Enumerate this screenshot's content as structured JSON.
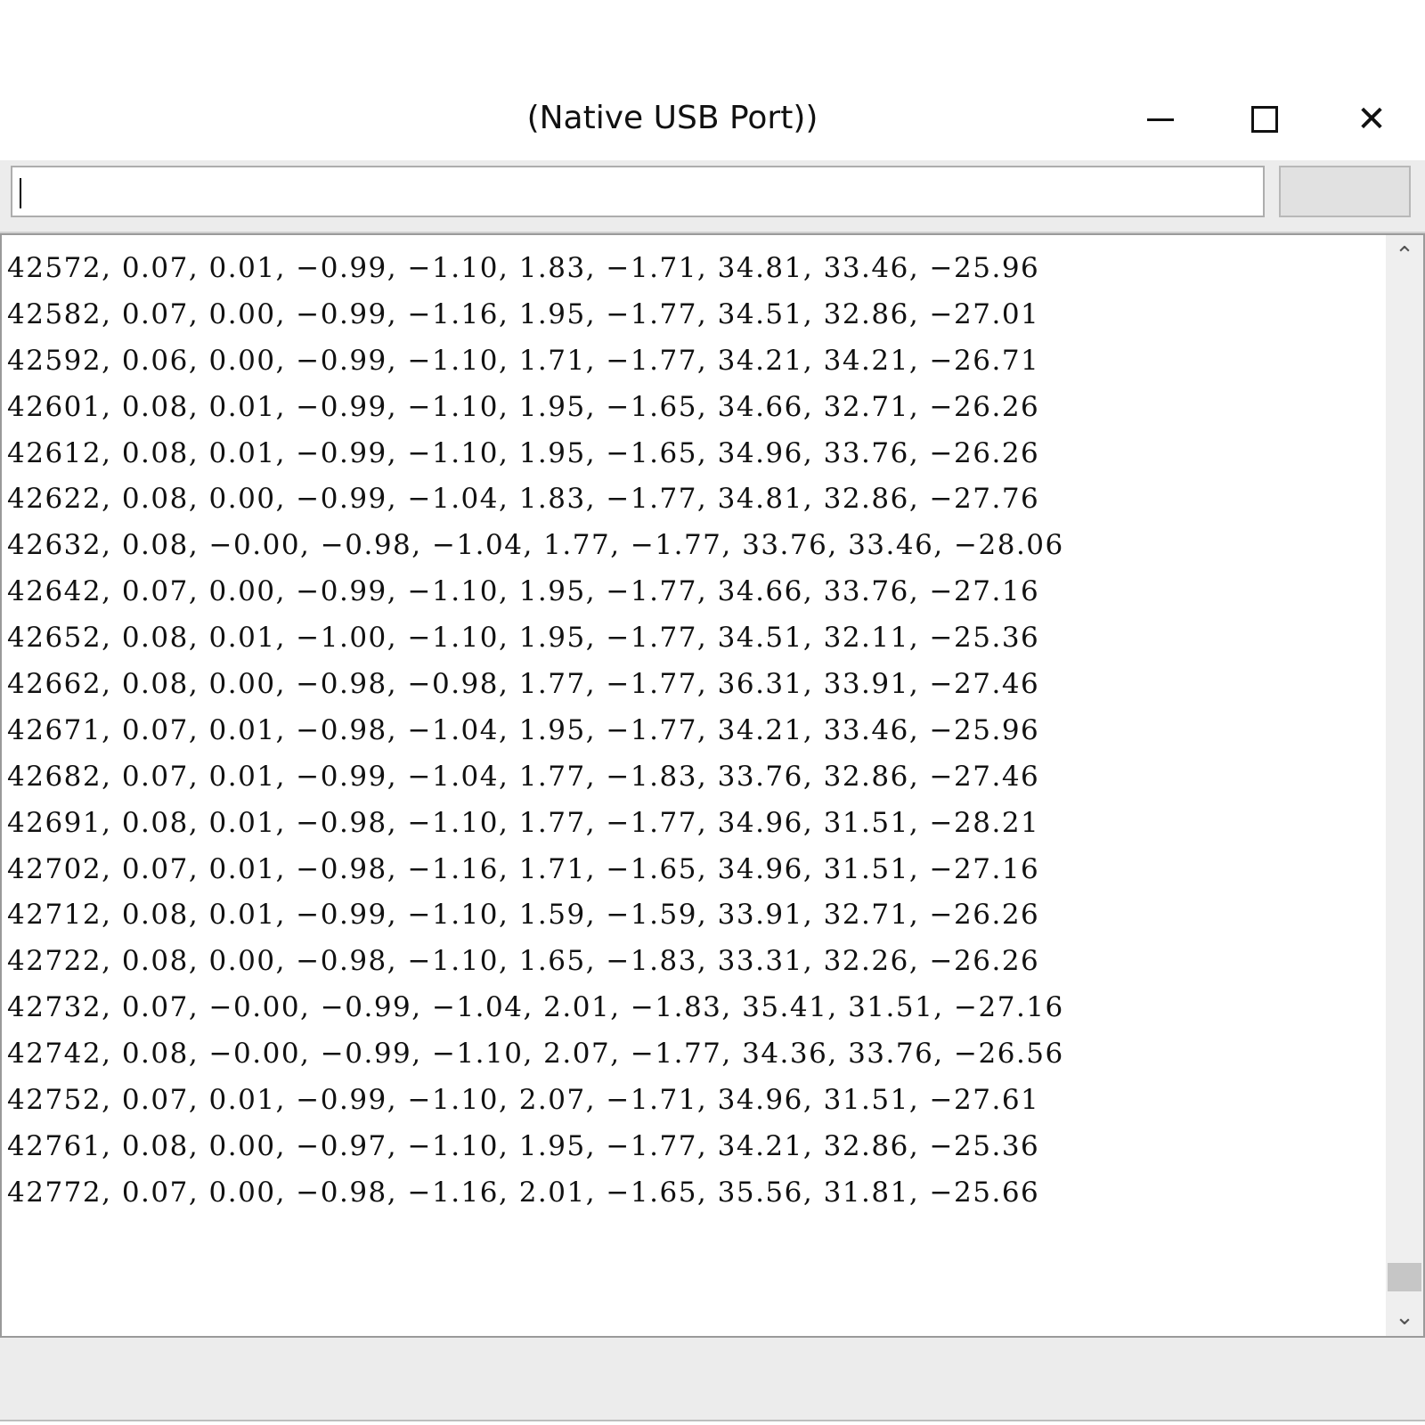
{
  "window": {
    "title": "(Native USB Port))",
    "close_glyph": "✕",
    "controls": [
      "minimize-icon",
      "maximize-icon",
      "close-icon"
    ]
  },
  "toolbar": {
    "input_value": "",
    "send_label": ""
  },
  "serial_output": {
    "lines": [
      "42572, 0.07, 0.01, −0.99, −1.10, 1.83, −1.71, 34.81, 33.46, −25.96",
      "42582, 0.07, 0.00, −0.99, −1.16, 1.95, −1.77, 34.51, 32.86, −27.01",
      "42592, 0.06, 0.00, −0.99, −1.10, 1.71, −1.77, 34.21, 34.21, −26.71",
      "42601, 0.08, 0.01, −0.99, −1.10, 1.95, −1.65, 34.66, 32.71, −26.26",
      "42612, 0.08, 0.01, −0.99, −1.10, 1.95, −1.65, 34.96, 33.76, −26.26",
      "42622, 0.08, 0.00, −0.99, −1.04, 1.83, −1.77, 34.81, 32.86, −27.76",
      "42632, 0.08, −0.00, −0.98, −1.04, 1.77, −1.77, 33.76, 33.46, −28.06",
      "42642, 0.07, 0.00, −0.99, −1.10, 1.95, −1.77, 34.66, 33.76, −27.16",
      "42652, 0.08, 0.01, −1.00, −1.10, 1.95, −1.77, 34.51, 32.11, −25.36",
      "42662, 0.08, 0.00, −0.98, −0.98, 1.77, −1.77, 36.31, 33.91, −27.46",
      "42671, 0.07, 0.01, −0.98, −1.04, 1.95, −1.77, 34.21, 33.46, −25.96",
      "42682, 0.07, 0.01, −0.99, −1.04, 1.77, −1.83, 33.76, 32.86, −27.46",
      "42691, 0.08, 0.01, −0.98, −1.10, 1.77, −1.77, 34.96, 31.51, −28.21",
      "42702, 0.07, 0.01, −0.98, −1.16, 1.71, −1.65, 34.96, 31.51, −27.16",
      "42712, 0.08, 0.01, −0.99, −1.10, 1.59, −1.59, 33.91, 32.71, −26.26",
      "42722, 0.08, 0.00, −0.98, −1.10, 1.65, −1.83, 33.31, 32.26, −26.26",
      "42732, 0.07, −0.00, −0.99, −1.04, 2.01, −1.83, 35.41, 31.51, −27.16",
      "42742, 0.08, −0.00, −0.99, −1.10, 2.07, −1.77, 34.36, 33.76, −26.56",
      "42752, 0.07, 0.01, −0.99, −1.10, 2.07, −1.71, 34.96, 31.51, −27.61",
      "42761, 0.08, 0.00, −0.97, −1.10, 1.95, −1.77, 34.21, 32.86, −25.36",
      "42772, 0.07, 0.00, −0.98, −1.16, 2.01, −1.65, 35.56, 31.81, −25.66"
    ]
  },
  "scrollbar": {
    "up_glyph": "⌃",
    "down_glyph": "⌄"
  }
}
